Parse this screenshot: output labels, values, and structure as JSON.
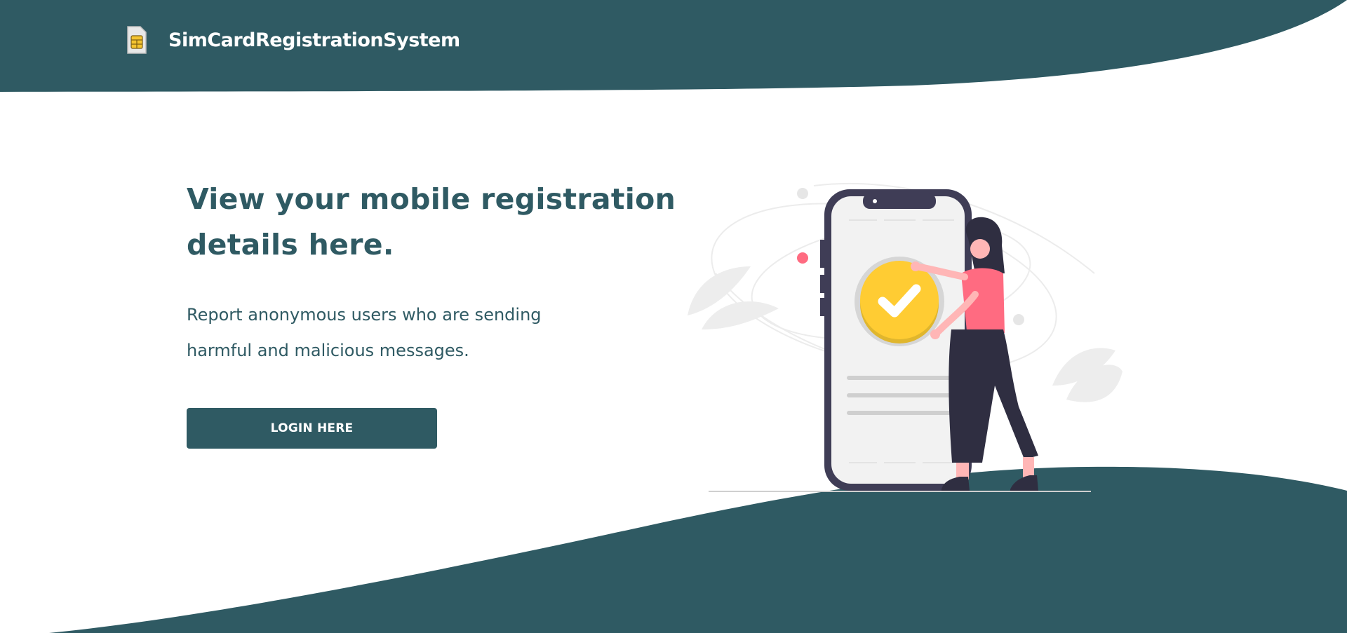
{
  "app": {
    "brand_name": "SimCardRegistrationSystem",
    "logo_icon": "sim-card-icon"
  },
  "hero": {
    "title": "View your mobile registration details here.",
    "subtitle": "Report anonymous users who are sending harmful and malicious messages.",
    "login_button_label": "LOGIN HERE"
  },
  "illustration": {
    "name": "woman-with-phone-checkmark-illustration"
  },
  "colors": {
    "primary": "#2f5a63",
    "accent_yellow": "#ffcc33",
    "accent_pink": "#ff6b81",
    "phone_frame": "#3f3d56"
  }
}
